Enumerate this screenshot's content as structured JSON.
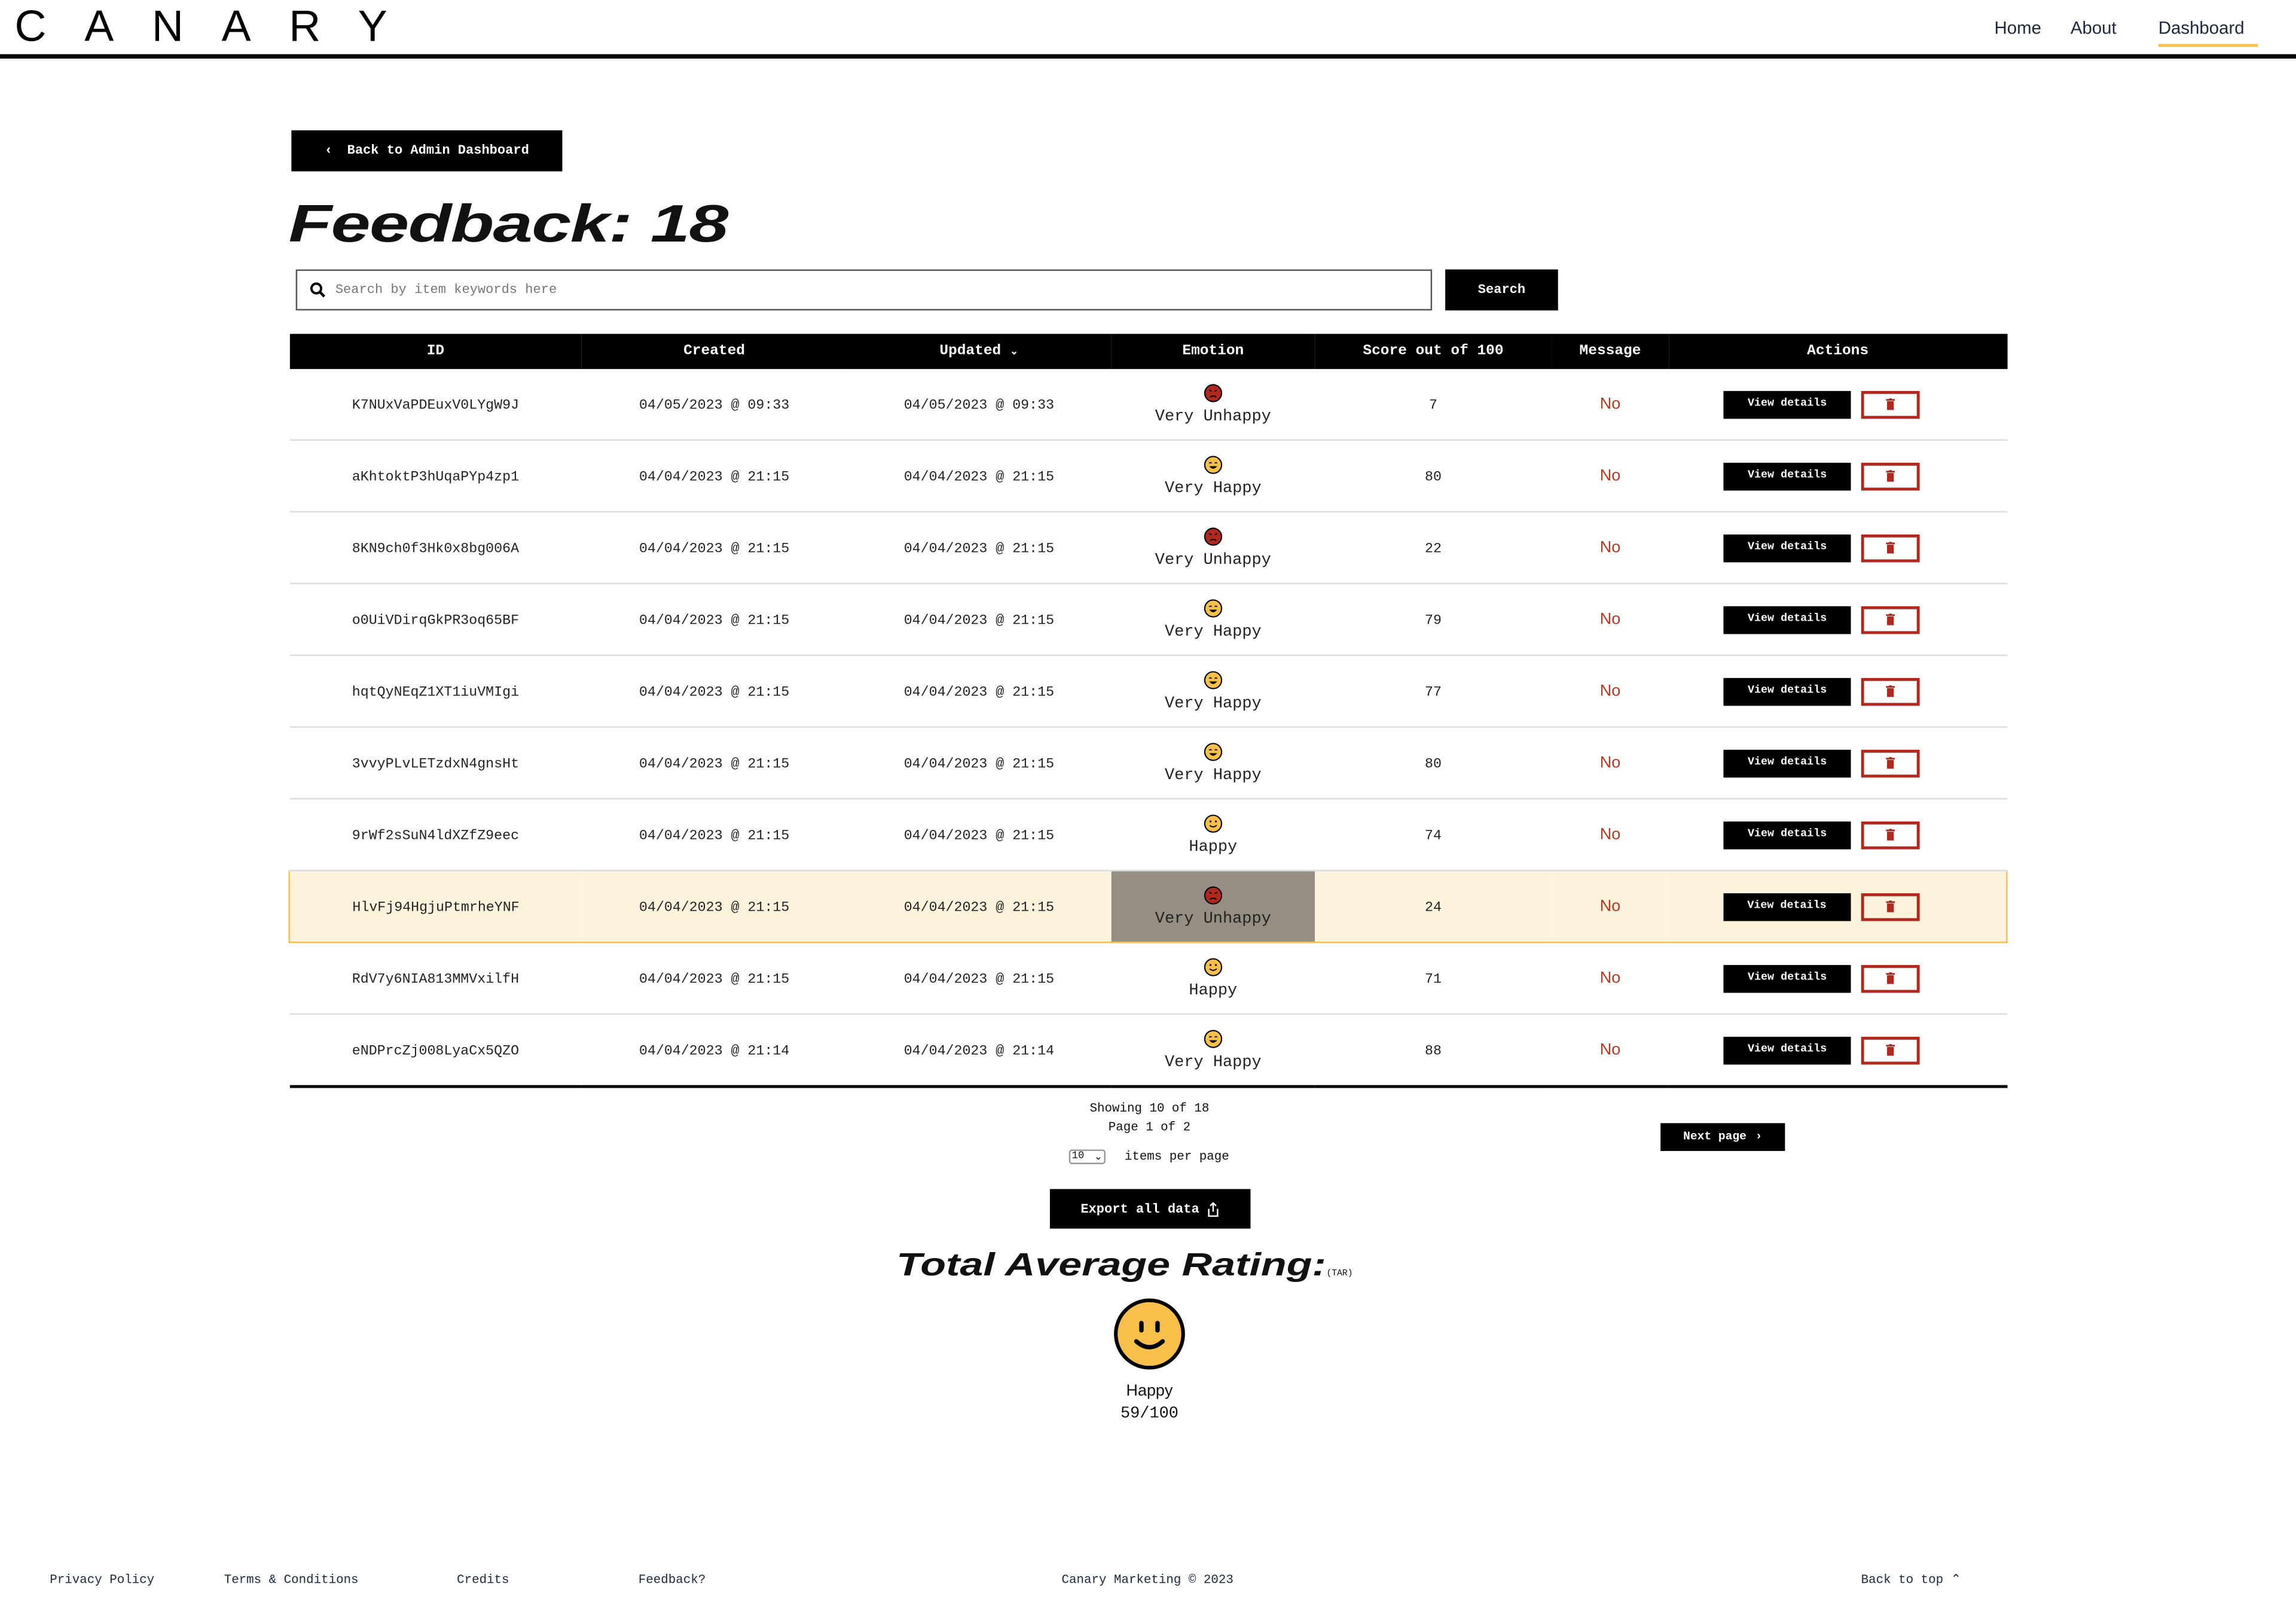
{
  "brand": {
    "logo": "CANARY"
  },
  "nav": {
    "items": [
      "Home",
      "About",
      "Dashboard"
    ],
    "active": "Dashboard"
  },
  "back_button": "Back to Admin Dashboard",
  "page_title": "Feedback: 18",
  "search": {
    "placeholder": "Search by item keywords here",
    "value": "",
    "button": "Search"
  },
  "table": {
    "headers": [
      "ID",
      "Created",
      "Updated",
      "Emotion",
      "Score out of 100",
      "Message",
      "Actions"
    ],
    "sorted_column": "Updated",
    "rows": [
      {
        "id": "K7NUxVaPDEuxV0LYgW9J",
        "created": "04/05/2023 @ 09:33",
        "updated": "04/05/2023 @ 09:33",
        "emotion": "Very Unhappy",
        "score": "7",
        "message": "No"
      },
      {
        "id": "aKhtoktP3hUqaPYp4zp1",
        "created": "04/04/2023 @ 21:15",
        "updated": "04/04/2023 @ 21:15",
        "emotion": "Very Happy",
        "score": "80",
        "message": "No"
      },
      {
        "id": "8KN9ch0f3Hk0x8bg006A",
        "created": "04/04/2023 @ 21:15",
        "updated": "04/04/2023 @ 21:15",
        "emotion": "Very Unhappy",
        "score": "22",
        "message": "No"
      },
      {
        "id": "o0UiVDirqGkPR3oq65BF",
        "created": "04/04/2023 @ 21:15",
        "updated": "04/04/2023 @ 21:15",
        "emotion": "Very Happy",
        "score": "79",
        "message": "No"
      },
      {
        "id": "hqtQyNEqZ1XT1iuVMIgi",
        "created": "04/04/2023 @ 21:15",
        "updated": "04/04/2023 @ 21:15",
        "emotion": "Very Happy",
        "score": "77",
        "message": "No"
      },
      {
        "id": "3vvyPLvLETzdxN4gnsHt",
        "created": "04/04/2023 @ 21:15",
        "updated": "04/04/2023 @ 21:15",
        "emotion": "Very Happy",
        "score": "80",
        "message": "No"
      },
      {
        "id": "9rWf2sSuN4ldXZfZ9eec",
        "created": "04/04/2023 @ 21:15",
        "updated": "04/04/2023 @ 21:15",
        "emotion": "Happy",
        "score": "74",
        "message": "No"
      },
      {
        "id": "HlvFj94HgjuPtmrheYNF",
        "created": "04/04/2023 @ 21:15",
        "updated": "04/04/2023 @ 21:15",
        "emotion": "Very Unhappy",
        "score": "24",
        "message": "No",
        "highlighted": true
      },
      {
        "id": "RdV7y6NIA813MMVxilfH",
        "created": "04/04/2023 @ 21:15",
        "updated": "04/04/2023 @ 21:15",
        "emotion": "Happy",
        "score": "71",
        "message": "No"
      },
      {
        "id": "eNDPrcZj008LyaCx5QZO",
        "created": "04/04/2023 @ 21:14",
        "updated": "04/04/2023 @ 21:14",
        "emotion": "Very Happy",
        "score": "88",
        "message": "No"
      }
    ],
    "view_label": "View details"
  },
  "pagination": {
    "showing": "Showing 10 of 18",
    "page": "Page 1 of 2",
    "per_page_value": "10",
    "per_page_label": "items per page",
    "next": "Next page"
  },
  "export_button": "Export all data",
  "tar": {
    "title": "Total Average Rating:",
    "abbr": "(TAR)",
    "emotion": "Happy",
    "score": "59/100"
  },
  "footer": {
    "links": [
      "Privacy Policy",
      "Terms & Conditions",
      "Credits",
      "Feedback?"
    ],
    "copyright": "Canary Marketing © 2023",
    "back_to_top": "Back to top"
  },
  "colors": {
    "accent": "#f8bf4a",
    "danger": "#b0281e",
    "highlight_row": "#fdf2dc",
    "highlight_cell": "#968e83"
  }
}
